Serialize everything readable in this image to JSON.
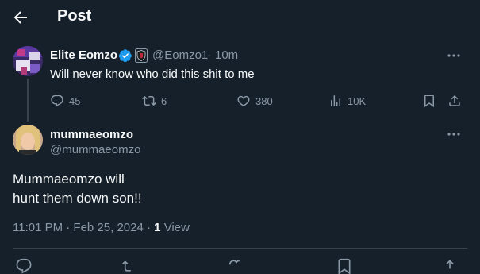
{
  "header": {
    "title": "Post"
  },
  "original_post": {
    "display_name": "Elite Eomzo",
    "handle": "@Eomzo1",
    "separator": "·",
    "time": "10m",
    "text": "Will never know who did this shit to me",
    "stats": {
      "replies": "45",
      "reposts": "6",
      "likes": "380",
      "views": "10K"
    },
    "verified_color": "#1d9bf0"
  },
  "reply": {
    "display_name": "mummaeomzo",
    "handle": "@mummaeomzo",
    "text_line1": "Mummaeomzo will",
    "text_line2": "hunt them down son!!",
    "timestamp": "11:01 PM · Feb 25, 2024 ·",
    "views_count": "1",
    "views_label": "View"
  },
  "icons": {
    "back": "arrow-left-icon",
    "verified": "verified-badge-icon",
    "affiliate": "affiliate-badge-icon",
    "more": "more-horizontal-icon",
    "reply": "reply-icon",
    "repost": "repost-icon",
    "like": "heart-icon",
    "views": "analytics-icon",
    "bookmark": "bookmark-icon",
    "share": "share-icon"
  },
  "colors": {
    "background": "#15202b",
    "text": "#f7f9f9",
    "muted": "#8b98a5",
    "accent": "#1d9bf0",
    "border": "#38444d"
  }
}
